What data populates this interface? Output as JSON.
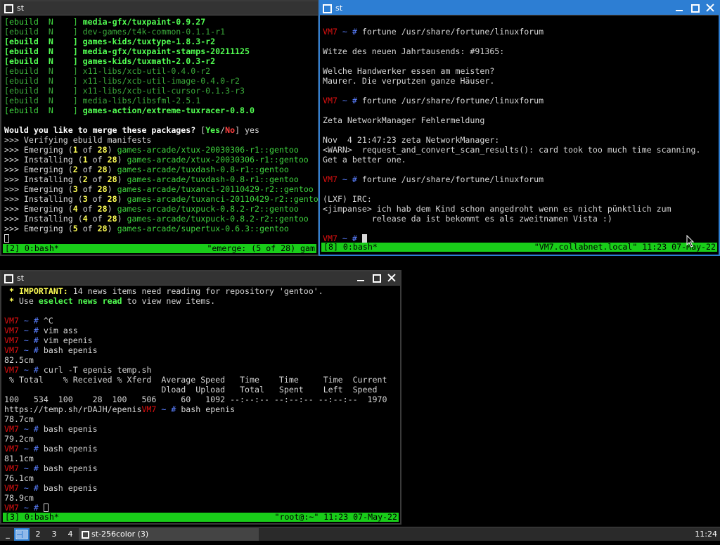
{
  "windows": {
    "top_left": {
      "title": "st",
      "lines": [
        [
          [
            "g",
            "[ebuild  N    ] "
          ],
          [
            "gb",
            "media-gfx/tuxpaint-0.9.27"
          ]
        ],
        [
          [
            "dim",
            "[ebuild  N    ] dev-games/t4k-common-0.1.1-r1"
          ]
        ],
        [
          [
            "gb",
            "[ebuild  N    ] games-kids/tuxtype-1.8.3-r2"
          ]
        ],
        [
          [
            "gb",
            "[ebuild  N    ] media-gfx/tuxpaint-stamps-20211125"
          ]
        ],
        [
          [
            "gb",
            "[ebuild  N    ] games-kids/tuxmath-2.0.3-r2"
          ]
        ],
        [
          [
            "dim",
            "[ebuild  N    ] x11-libs/xcb-util-0.4.0-r2"
          ]
        ],
        [
          [
            "dim",
            "[ebuild  N    ] x11-libs/xcb-util-image-0.4.0-r2"
          ]
        ],
        [
          [
            "dim",
            "[ebuild  N    ] x11-libs/xcb-util-cursor-0.1.3-r3"
          ]
        ],
        [
          [
            "dim",
            "[ebuild  N    ] media-libs/libsfml-2.5.1"
          ]
        ],
        [
          [
            "g",
            "[ebuild  N    ] "
          ],
          [
            "gb",
            "games-action/extreme-tuxracer-0.8.0"
          ]
        ],
        [],
        [
          [
            "w",
            "Would you like to merge these packages? "
          ],
          [
            "",
            "["
          ],
          [
            "gb",
            "Yes"
          ],
          [
            "",
            "/"
          ],
          [
            "rb",
            "No"
          ],
          [
            "",
            "] yes"
          ]
        ],
        [
          [
            "",
            ">>> Verifying ebuild manifests"
          ]
        ],
        [
          [
            "",
            ">>> Emerging ("
          ],
          [
            "y",
            "1"
          ],
          [
            "",
            " of "
          ],
          [
            "y",
            "28"
          ],
          [
            "",
            ") "
          ],
          [
            "g",
            "games-arcade/xtux-20030306-r1::gentoo"
          ]
        ],
        [
          [
            "",
            ">>> Installing ("
          ],
          [
            "y",
            "1"
          ],
          [
            "",
            " of "
          ],
          [
            "y",
            "28"
          ],
          [
            "",
            ") "
          ],
          [
            "g",
            "games-arcade/xtux-20030306-r1::gentoo"
          ]
        ],
        [
          [
            "",
            ">>> Emerging ("
          ],
          [
            "y",
            "2"
          ],
          [
            "",
            " of "
          ],
          [
            "y",
            "28"
          ],
          [
            "",
            ") "
          ],
          [
            "g",
            "games-arcade/tuxdash-0.8-r1::gentoo"
          ]
        ],
        [
          [
            "",
            ">>> Installing ("
          ],
          [
            "y",
            "2"
          ],
          [
            "",
            " of "
          ],
          [
            "y",
            "28"
          ],
          [
            "",
            ") "
          ],
          [
            "g",
            "games-arcade/tuxdash-0.8-r1::gentoo"
          ]
        ],
        [
          [
            "",
            ">>> Emerging ("
          ],
          [
            "y",
            "3"
          ],
          [
            "",
            " of "
          ],
          [
            "y",
            "28"
          ],
          [
            "",
            ") "
          ],
          [
            "g",
            "games-arcade/tuxanci-20110429-r2::gentoo"
          ]
        ],
        [
          [
            "",
            ">>> Installing ("
          ],
          [
            "y",
            "3"
          ],
          [
            "",
            " of "
          ],
          [
            "y",
            "28"
          ],
          [
            "",
            ") "
          ],
          [
            "g",
            "games-arcade/tuxanci-20110429-r2::gentoo"
          ]
        ],
        [
          [
            "",
            ">>> Emerging ("
          ],
          [
            "y",
            "4"
          ],
          [
            "",
            " of "
          ],
          [
            "y",
            "28"
          ],
          [
            "",
            ") "
          ],
          [
            "g",
            "games-arcade/tuxpuck-0.8.2-r2::gentoo"
          ]
        ],
        [
          [
            "",
            ">>> Installing ("
          ],
          [
            "y",
            "4"
          ],
          [
            "",
            " of "
          ],
          [
            "y",
            "28"
          ],
          [
            "",
            ") "
          ],
          [
            "g",
            "games-arcade/tuxpuck-0.8.2-r2::gentoo"
          ]
        ],
        [
          [
            "",
            ">>> Emerging ("
          ],
          [
            "y",
            "5"
          ],
          [
            "",
            " of "
          ],
          [
            "y",
            "28"
          ],
          [
            "",
            ") "
          ],
          [
            "g",
            "games-arcade/supertux-0.6.3::gentoo"
          ]
        ]
      ],
      "status_left": "[2] 0:bash*",
      "status_right": "\"emerge: (5 of 28) gam"
    },
    "top_right": {
      "title": "st",
      "lines": [
        [],
        [
          [
            "r",
            "VM7"
          ],
          [
            "b",
            " ~ # "
          ],
          [
            "",
            "fortune /usr/share/fortune/linuxforum"
          ]
        ],
        [],
        [
          [
            "",
            "Witze des neuen Jahrtausends: #91365:"
          ]
        ],
        [],
        [
          [
            "",
            "Welche Handwerker essen am meisten?"
          ]
        ],
        [
          [
            "",
            "Maurer. Die verputzen ganze Häuser."
          ]
        ],
        [],
        [
          [
            "r",
            "VM7"
          ],
          [
            "b",
            " ~ # "
          ],
          [
            "",
            "fortune /usr/share/fortune/linuxforum"
          ]
        ],
        [],
        [
          [
            "",
            "Zeta NetworkManager Fehlermeldung"
          ]
        ],
        [],
        [
          [
            "",
            "Nov  4 21:47:23 zeta NetworkManager:"
          ]
        ],
        [
          [
            "",
            "<WARN>  request_and_convert_scan_results(): card took too much time scanning."
          ]
        ],
        [
          [
            "",
            "Get a better one."
          ]
        ],
        [],
        [
          [
            "r",
            "VM7"
          ],
          [
            "b",
            " ~ # "
          ],
          [
            "",
            "fortune /usr/share/fortune/linuxforum"
          ]
        ],
        [],
        [
          [
            "",
            "(LXF) IRC:"
          ]
        ],
        [
          [
            "",
            "<jimpanse> ich hab dem Kind schon angedroht wenn es nicht pünktlich zum"
          ]
        ],
        [
          [
            "",
            "          release da ist bekommt es als zweitnamen Vista :)"
          ]
        ],
        [],
        [
          [
            "r",
            "VM7"
          ],
          [
            "b",
            " ~ # "
          ]
        ]
      ],
      "status_left": "[8] 0:bash*",
      "status_right": "\"VM7.collabnet.local\" 11:23 07-May-22"
    },
    "bottom": {
      "title": "st",
      "lines": [
        [
          [
            "y",
            " * IMPORTANT:"
          ],
          [
            "",
            " 14 news items need reading for repository 'gentoo'."
          ]
        ],
        [
          [
            "y",
            " *"
          ],
          [
            "",
            " Use "
          ],
          [
            "gb",
            "eselect news read"
          ],
          [
            "",
            " to view new items."
          ]
        ],
        [],
        [
          [
            "r",
            "VM7"
          ],
          [
            "b",
            " ~ # "
          ],
          [
            "",
            "^C"
          ]
        ],
        [
          [
            "r",
            "VM7"
          ],
          [
            "b",
            " ~ # "
          ],
          [
            "",
            "vim ass"
          ]
        ],
        [
          [
            "r",
            "VM7"
          ],
          [
            "b",
            " ~ # "
          ],
          [
            "",
            "vim epenis"
          ]
        ],
        [
          [
            "r",
            "VM7"
          ],
          [
            "b",
            " ~ # "
          ],
          [
            "",
            "bash epenis"
          ]
        ],
        [
          [
            "",
            "82.5cm"
          ]
        ],
        [
          [
            "r",
            "VM7"
          ],
          [
            "b",
            " ~ # "
          ],
          [
            "",
            "curl -T epenis temp.sh"
          ]
        ],
        [
          [
            "",
            " % Total    % Received % Xferd  Average Speed   Time    Time     Time  Current"
          ]
        ],
        [
          [
            "",
            "                                Dload  Upload   Total   Spent    Left  Speed"
          ]
        ],
        [
          [
            "",
            "100   534  100    28  100   506     60   1092 --:--:-- --:--:-- --:--:--  1970"
          ]
        ],
        [
          [
            "",
            "https://temp.sh/rDAJH/epenis"
          ],
          [
            "r",
            "VM7"
          ],
          [
            "b",
            " ~ # "
          ],
          [
            "",
            "bash epenis"
          ]
        ],
        [
          [
            "",
            "78.7cm"
          ]
        ],
        [
          [
            "r",
            "VM7"
          ],
          [
            "b",
            " ~ # "
          ],
          [
            "",
            "bash epenis"
          ]
        ],
        [
          [
            "",
            "79.2cm"
          ]
        ],
        [
          [
            "r",
            "VM7"
          ],
          [
            "b",
            " ~ # "
          ],
          [
            "",
            "bash epenis"
          ]
        ],
        [
          [
            "",
            "81.1cm"
          ]
        ],
        [
          [
            "r",
            "VM7"
          ],
          [
            "b",
            " ~ # "
          ],
          [
            "",
            "bash epenis"
          ]
        ],
        [
          [
            "",
            "76.1cm"
          ]
        ],
        [
          [
            "r",
            "VM7"
          ],
          [
            "b",
            " ~ # "
          ],
          [
            "",
            "bash epenis"
          ]
        ],
        [
          [
            "",
            "78.9cm"
          ]
        ],
        [
          [
            "r",
            "VM7"
          ],
          [
            "b",
            " ~ # "
          ]
        ]
      ],
      "status_left": "[3] 0:bash*",
      "status_right": "\"root@:~\" 11:23 07-May-22"
    }
  },
  "panel": {
    "menu": "_",
    "workspaces": [
      "2",
      "3",
      "4"
    ],
    "task_label": "st-256color (3)",
    "clock": "11:24"
  },
  "colors": {
    "accent": "#2d7ed3",
    "status_green": "#19cd19",
    "prompt_red": "#e01010"
  }
}
